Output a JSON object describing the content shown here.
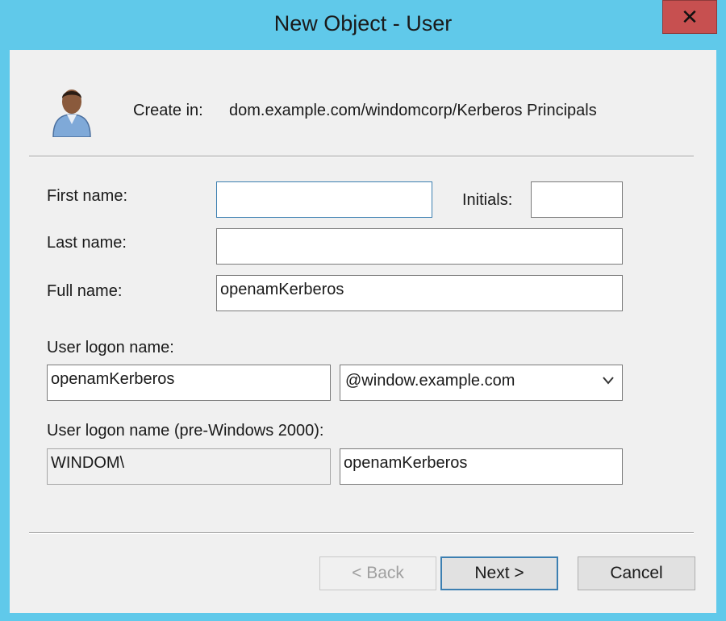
{
  "window": {
    "title": "New Object - User",
    "close_glyph": "✕"
  },
  "header": {
    "icon": "user-icon",
    "create_in_label": "Create in:",
    "create_in_path": "dom.example.com/windomcorp/Kerberos Principals"
  },
  "form": {
    "first_name_label": "First name:",
    "first_name_value": "",
    "initials_label": "Initials:",
    "initials_value": "",
    "last_name_label": "Last name:",
    "last_name_value": "",
    "full_name_label": "Full name:",
    "full_name_value": "openamKerberos",
    "logon_name_label": "User logon name:",
    "logon_name_value": "openamKerberos",
    "domain_suffix_selected": "@window.example.com",
    "pre2000_label": "User logon name (pre-Windows 2000):",
    "pre2000_domain": "WINDOM\\",
    "pre2000_user": "openamKerberos"
  },
  "buttons": {
    "back": "< Back",
    "next": "Next >",
    "cancel": "Cancel"
  },
  "colors": {
    "title_bar": "#60c9ea",
    "close": "#c75050",
    "focus_border": "#3c7fb1"
  }
}
